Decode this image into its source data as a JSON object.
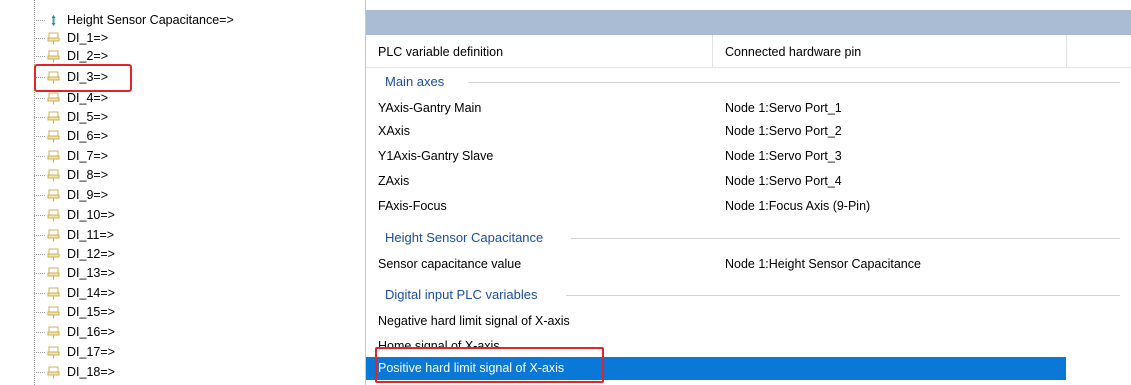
{
  "tree": {
    "items": [
      {
        "label": "Height Sensor Capacitance=>",
        "icon": "pin-icon"
      },
      {
        "label": "DI_1=>",
        "icon": "plug-icon"
      },
      {
        "label": "DI_2=>",
        "icon": "plug-icon"
      },
      {
        "label": "DI_3=>",
        "icon": "plug-icon"
      },
      {
        "label": "DI_4=>",
        "icon": "plug-icon"
      },
      {
        "label": "DI_5=>",
        "icon": "plug-icon"
      },
      {
        "label": "DI_6=>",
        "icon": "plug-icon"
      },
      {
        "label": "DI_7=>",
        "icon": "plug-icon"
      },
      {
        "label": "DI_8=>",
        "icon": "plug-icon"
      },
      {
        "label": "DI_9=>",
        "icon": "plug-icon"
      },
      {
        "label": "DI_10=>",
        "icon": "plug-icon"
      },
      {
        "label": "DI_11=>",
        "icon": "plug-icon"
      },
      {
        "label": "DI_12=>",
        "icon": "plug-icon"
      },
      {
        "label": "DI_13=>",
        "icon": "plug-icon"
      },
      {
        "label": "DI_14=>",
        "icon": "plug-icon"
      },
      {
        "label": "DI_15=>",
        "icon": "plug-icon"
      },
      {
        "label": "DI_16=>",
        "icon": "plug-icon"
      },
      {
        "label": "DI_17=>",
        "icon": "plug-icon"
      },
      {
        "label": "DI_18=>",
        "icon": "plug-icon"
      }
    ]
  },
  "grid": {
    "columns": [
      "PLC variable definition",
      "Connected hardware pin"
    ],
    "sections": [
      {
        "title": "Main axes",
        "rows": [
          {
            "variable": "YAxis-Gantry Main",
            "pin": "Node 1:Servo Port_1"
          },
          {
            "variable": "XAxis",
            "pin": "Node 1:Servo Port_2"
          },
          {
            "variable": "Y1Axis-Gantry Slave",
            "pin": "Node 1:Servo Port_3"
          },
          {
            "variable": "ZAxis",
            "pin": "Node 1:Servo Port_4"
          },
          {
            "variable": "FAxis-Focus",
            "pin": "Node 1:Focus Axis (9-Pin)"
          }
        ]
      },
      {
        "title": "Height Sensor Capacitance",
        "rows": [
          {
            "variable": "Sensor capacitance value",
            "pin": "Node 1:Height Sensor Capacitance"
          }
        ]
      },
      {
        "title": "Digital input PLC variables",
        "rows": [
          {
            "variable": "Negative hard limit signal of X-axis",
            "pin": ""
          },
          {
            "variable": "Home signal of X-axis",
            "pin": ""
          },
          {
            "variable": "Positive hard limit signal of X-axis",
            "pin": "",
            "selected": true
          }
        ]
      }
    ]
  },
  "colors": {
    "selection": "#0a78d7",
    "section_title": "#1c4da1",
    "header_bar": "#a9bcd4",
    "highlight_box": "#e3242b"
  }
}
